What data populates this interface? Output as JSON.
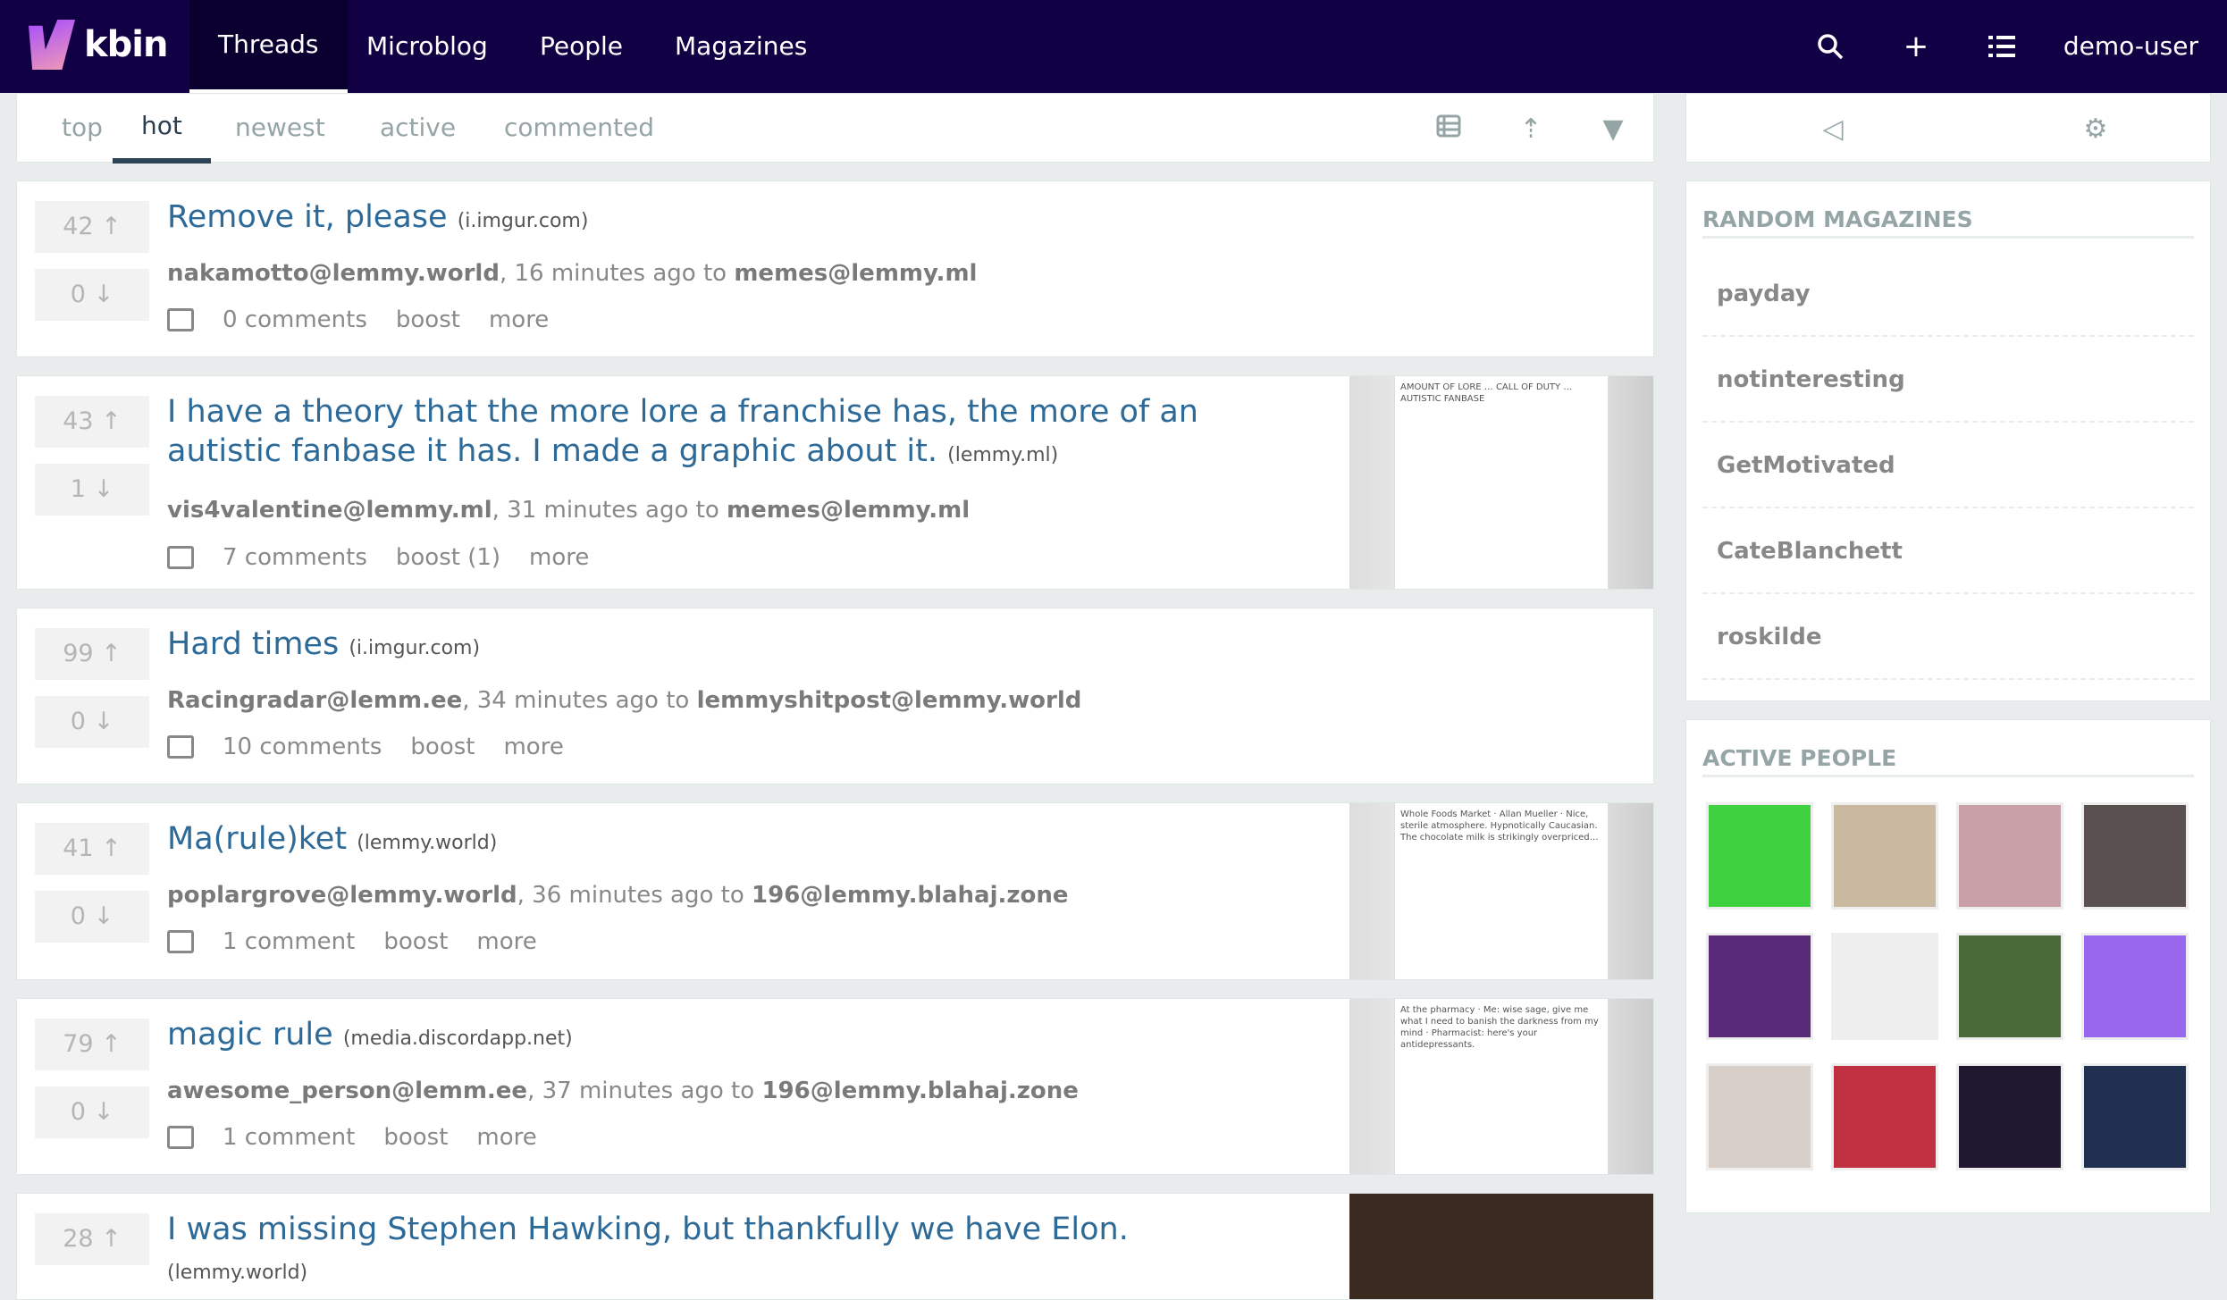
{
  "nav": {
    "brand": "kbin",
    "items": [
      "Threads",
      "Microblog",
      "People",
      "Magazines"
    ],
    "active": "Threads",
    "user": "demo-user",
    "icons": [
      "search-icon",
      "plus-icon",
      "list-icon"
    ]
  },
  "subnav": {
    "tabs": [
      "top",
      "hot",
      "newest",
      "active",
      "commented"
    ],
    "active": "hot",
    "icons": [
      "view-icon",
      "sort-icon",
      "filter-icon"
    ]
  },
  "posts": [
    {
      "up": "42",
      "down": "0",
      "title": "Remove it, please",
      "domain": "(i.imgur.com)",
      "author": "nakamotto@lemmy.world",
      "time": ", 16 minutes ago to ",
      "magazine": "memes@lemmy.ml",
      "comments": "0 comments",
      "boost": "boost",
      "more": "more",
      "thumb": ""
    },
    {
      "up": "43",
      "down": "1",
      "title": "I have a theory that the more lore a franchise has, the more of an autistic fanbase it has. I made a graphic about it.",
      "domain": "(lemmy.ml)",
      "author": "vis4valentine@lemmy.ml",
      "time": ", 31 minutes ago to ",
      "magazine": "memes@lemmy.ml",
      "comments": "7 comments",
      "boost": "boost (1)",
      "more": "more",
      "thumb": "AMOUNT OF LORE … CALL OF DUTY … AUTISTIC FANBASE"
    },
    {
      "up": "99",
      "down": "0",
      "title": "Hard times",
      "domain": "(i.imgur.com)",
      "author": "Racingradar@lemm.ee",
      "time": ", 34 minutes ago to ",
      "magazine": "lemmyshitpost@lemmy.world",
      "comments": "10 comments",
      "boost": "boost",
      "more": "more",
      "thumb": ""
    },
    {
      "up": "41",
      "down": "0",
      "title": "Ma(rule)ket",
      "domain": "(lemmy.world)",
      "author": "poplargrove@lemmy.world",
      "time": ", 36 minutes ago to ",
      "magazine": "196@lemmy.blahaj.zone",
      "comments": "1 comment",
      "boost": "boost",
      "more": "more",
      "thumb": "Whole Foods Market · Allan Mueller · Nice, sterile atmosphere. Hypnotically Caucasian. The chocolate milk is strikingly overpriced…"
    },
    {
      "up": "79",
      "down": "0",
      "title": "magic rule",
      "domain": "(media.discordapp.net)",
      "author": "awesome_person@lemm.ee",
      "time": ", 37 minutes ago to ",
      "magazine": "196@lemmy.blahaj.zone",
      "comments": "1 comment",
      "boost": "boost",
      "more": "more",
      "thumb": "At the pharmacy · Me: wise sage, give me what I need to banish the darkness from my mind · Pharmacist: here's your antidepressants."
    },
    {
      "up": "28",
      "down": "0",
      "title": "I was missing Stephen Hawking, but thankfully we have Elon.",
      "domain": "(lemmy.world)",
      "author": "",
      "time": "",
      "magazine": "",
      "comments": "",
      "boost": "",
      "more": "",
      "thumb": ""
    }
  ],
  "sidebar": {
    "random_title": "RANDOM MAGAZINES",
    "magazines": [
      "payday",
      "notinteresting",
      "GetMotivated",
      "CateBlanchett",
      "roskilde"
    ],
    "people_title": "ACTIVE PEOPLE",
    "avatar_colors": [
      "#3fd13f",
      "#c9b9a0",
      "#c9a0a8",
      "#5a5050",
      "#5a2a7a",
      "#eeeeee",
      "#4a6a3a",
      "#9966ee",
      "#d8d0c8",
      "#c03040",
      "#201830",
      "#203050"
    ]
  },
  "colors": {
    "nav": "#120044",
    "link": "#2e6a98"
  }
}
